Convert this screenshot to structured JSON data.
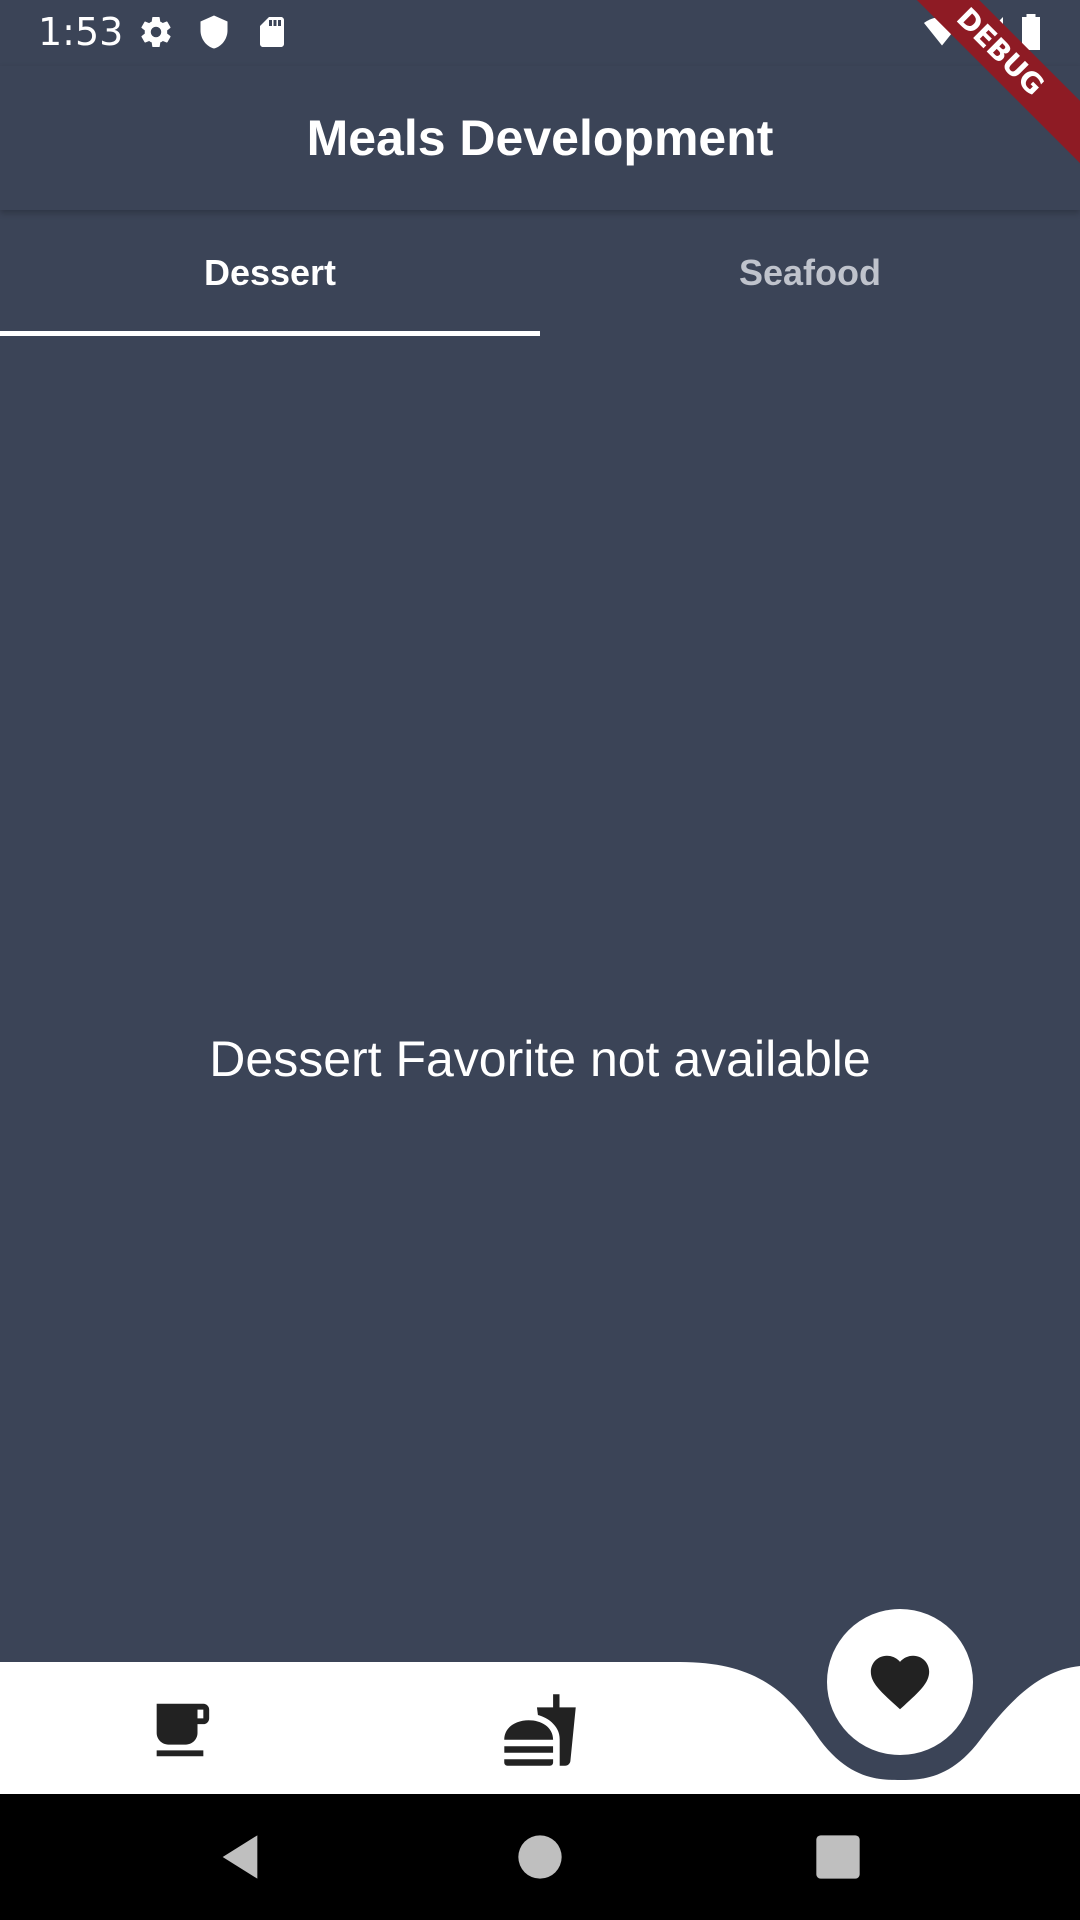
{
  "status_bar": {
    "time": "1:53",
    "left_icons": [
      "gear-icon",
      "shield-icon",
      "sd-card-icon"
    ],
    "right_icons": [
      "wifi-icon",
      "signal-icon",
      "battery-icon"
    ]
  },
  "debug_banner": {
    "label": "DEBUG",
    "color": "#8E1B24"
  },
  "app_bar": {
    "title": "Meals Development"
  },
  "tabs": [
    {
      "label": "Dessert",
      "selected": true
    },
    {
      "label": "Seafood",
      "selected": false
    }
  ],
  "content": {
    "message": "Dessert Favorite not available"
  },
  "bottom_nav": {
    "items": [
      {
        "icon": "coffee-cup-icon",
        "selected": false
      },
      {
        "icon": "fastfood-icon",
        "selected": false
      },
      {
        "icon": "heart-icon",
        "selected": true
      }
    ]
  },
  "system_nav": [
    "back-icon",
    "home-icon",
    "recents-icon"
  ],
  "colors": {
    "background": "#3B4457",
    "nav_bar": "#FFFFFF",
    "icon": "#222222",
    "inactive_tab": "#BFC3CC"
  }
}
